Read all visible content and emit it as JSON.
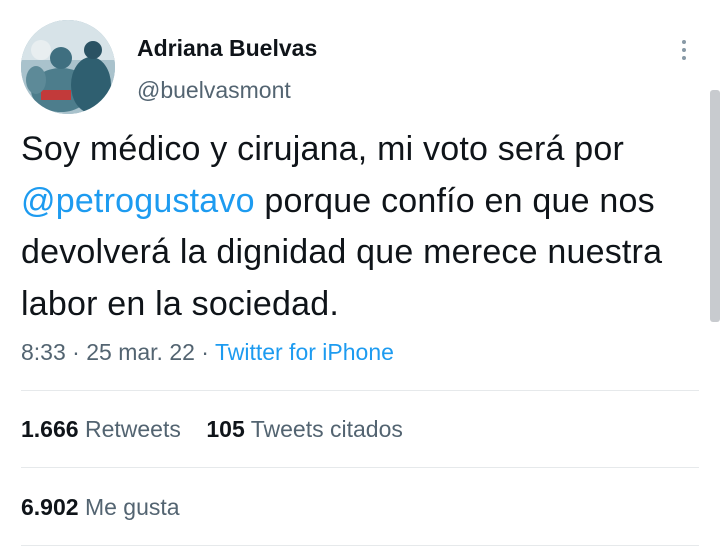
{
  "author": {
    "name": "Adriana Buelvas",
    "handle": "@buelvasmont"
  },
  "tweet": {
    "text_before": "Soy médico y cirujana, mi voto será por ",
    "mention": "@petrogustavo",
    "text_after": " porque confío en que nos devolverá la dignidad que merece nuestra labor en la sociedad."
  },
  "meta": {
    "time": "8:33",
    "sep1": " · ",
    "date": "25 mar. 22",
    "sep2": " · ",
    "source": "Twitter for iPhone"
  },
  "stats": {
    "retweets_count": "1.666",
    "retweets_label": "Retweets",
    "quotes_count": "105",
    "quotes_label": "Tweets citados",
    "likes_count": "6.902",
    "likes_label": "Me gusta"
  },
  "icons": {
    "more": "more-vertical-icon"
  }
}
